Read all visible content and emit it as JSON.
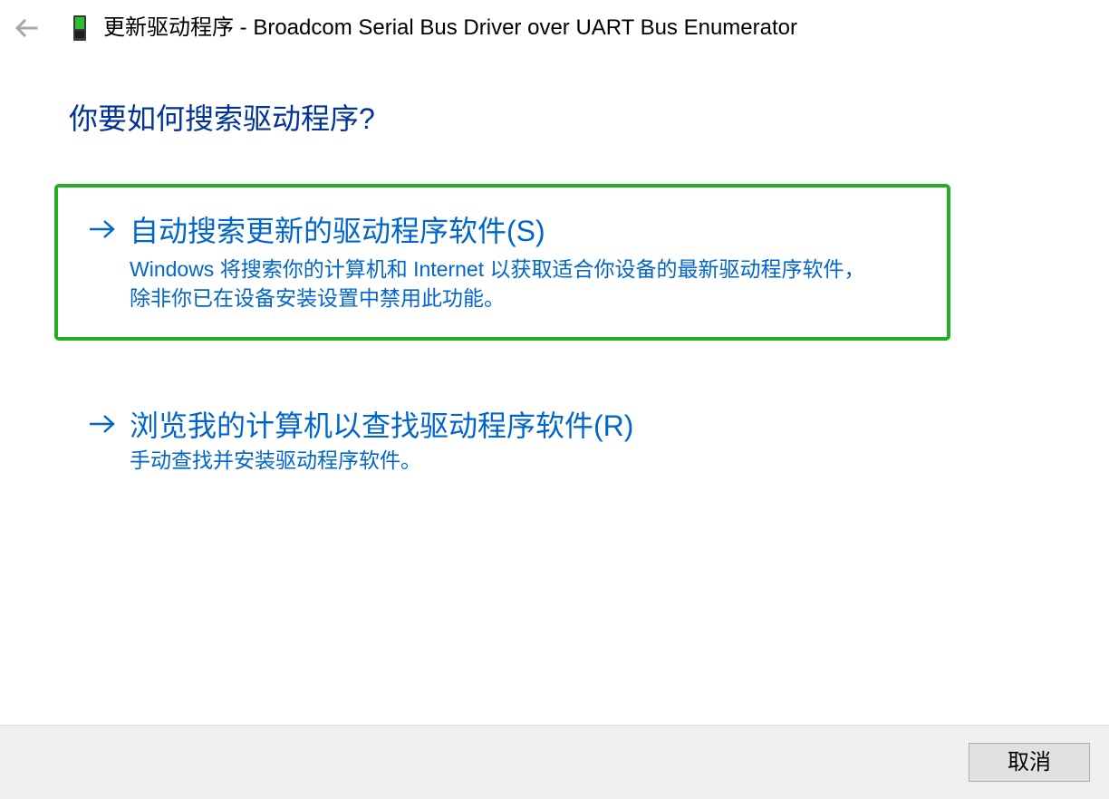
{
  "window": {
    "title": "更新驱动程序 - Broadcom Serial Bus Driver over UART Bus Enumerator"
  },
  "icons": {
    "back": "back-arrow-icon",
    "device": "device-icon",
    "option_arrow": "arrow-right-icon"
  },
  "heading": "你要如何搜索驱动程序?",
  "options": [
    {
      "title": "自动搜索更新的驱动程序软件(S)",
      "description_lines": [
        "Windows 将搜索你的计算机和 Internet 以获取适合你设备的最新驱动程序软件，",
        "除非你已在设备安装设置中禁用此功能。"
      ],
      "focused": true
    },
    {
      "title": "浏览我的计算机以查找驱动程序软件(R)",
      "description_lines": [
        "手动查找并安装驱动程序软件。"
      ],
      "focused": false
    }
  ],
  "footer": {
    "cancel_label": "取消"
  },
  "colors": {
    "heading": "#003399",
    "link": "#0066cc",
    "focus_border": "#22b022",
    "footer_bg": "#f0f0f0"
  }
}
